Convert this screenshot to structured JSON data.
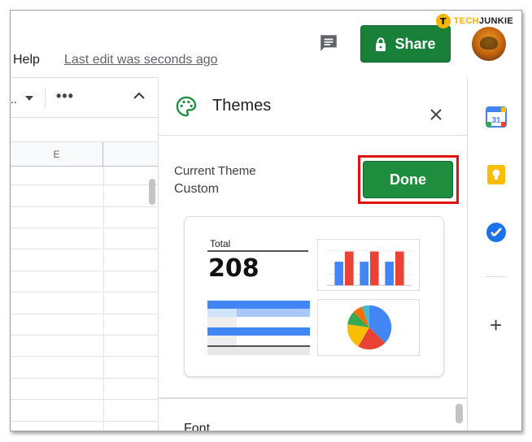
{
  "watermark": {
    "logo": "T",
    "part1": "TECH",
    "part2": "JUNKIE"
  },
  "menu": {
    "help": "Help",
    "last_edit": "Last edit was seconds ago"
  },
  "header": {
    "share_label": "Share"
  },
  "toolbar": {
    "dropdown_text": "..",
    "more": "•••"
  },
  "grid": {
    "column_header": "E"
  },
  "themes_panel": {
    "title": "Themes",
    "current_theme_label": "Current Theme",
    "current_theme_value": "Custom",
    "done_label": "Done",
    "preview": {
      "total_label": "Total",
      "total_value": "208"
    },
    "font_label": "Font"
  },
  "colors": {
    "share_green": "#188038",
    "done_green": "#1e8e3e",
    "highlight_red": "#e01010",
    "chart_blue": "#4285f4",
    "chart_red": "#ea4335",
    "chart_yellow": "#fbbc04",
    "chart_green": "#34a853",
    "chart_orange": "#ff6d01"
  },
  "icons": {
    "comment": "comment-icon",
    "lock": "lock-icon",
    "palette": "palette-icon",
    "close": "close-icon",
    "calendar": "calendar-icon",
    "keep": "keep-icon",
    "tasks": "tasks-icon",
    "add": "plus-icon"
  },
  "side_rail": {
    "calendar_day": "31",
    "add": "+"
  }
}
